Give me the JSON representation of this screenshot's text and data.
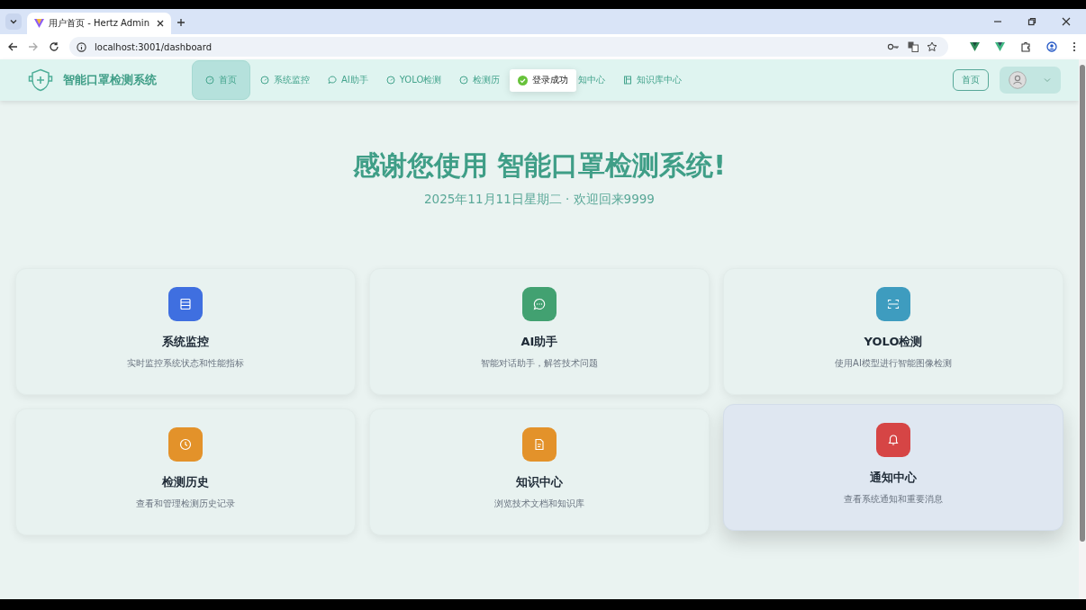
{
  "browser": {
    "tab_title": "用户首页 - Hertz Admin",
    "address": "localhost:3001/dashboard"
  },
  "header": {
    "brand": "智能口罩检测系统",
    "nav": [
      {
        "label": "首页",
        "kind": "gauge",
        "selected": true
      },
      {
        "label": "系统监控",
        "kind": "gauge",
        "selected": false
      },
      {
        "label": "AI助手",
        "kind": "chat",
        "selected": false
      },
      {
        "label": "YOLO检测",
        "kind": "gauge",
        "selected": false
      },
      {
        "label": "检测历",
        "kind": "gauge",
        "selected": false
      },
      {
        "label": "知中心",
        "kind": "plain",
        "selected": false
      },
      {
        "label": "知识库中心",
        "kind": "book",
        "selected": false
      }
    ],
    "toast": {
      "text": "登录成功"
    },
    "home_button": "首页"
  },
  "hero": {
    "title": "感谢您使用 智能口罩检测系统!",
    "subtitle": "2025年11月11日星期二 · 欢迎回来9999"
  },
  "cards": [
    {
      "title": "系统监控",
      "desc": "实时监控系统状态和性能指标",
      "kind": "server",
      "color": "#3f6fe0",
      "hovered": false
    },
    {
      "title": "AI助手",
      "desc": "智能对话助手，解答技术问题",
      "kind": "chat",
      "color": "#42a171",
      "hovered": false
    },
    {
      "title": "YOLO检测",
      "desc": "使用AI模型进行智能图像检测",
      "kind": "scan",
      "color": "#3e9cbf",
      "hovered": false
    },
    {
      "title": "检测历史",
      "desc": "查看和管理检测历史记录",
      "kind": "clock",
      "color": "#e3922a",
      "hovered": false
    },
    {
      "title": "知识中心",
      "desc": "浏览技术文档和知识库",
      "kind": "doc",
      "color": "#e3922a",
      "hovered": false
    },
    {
      "title": "通知中心",
      "desc": "查看系统通知和重要消息",
      "kind": "bell",
      "color": "#d64545",
      "hovered": true
    }
  ]
}
